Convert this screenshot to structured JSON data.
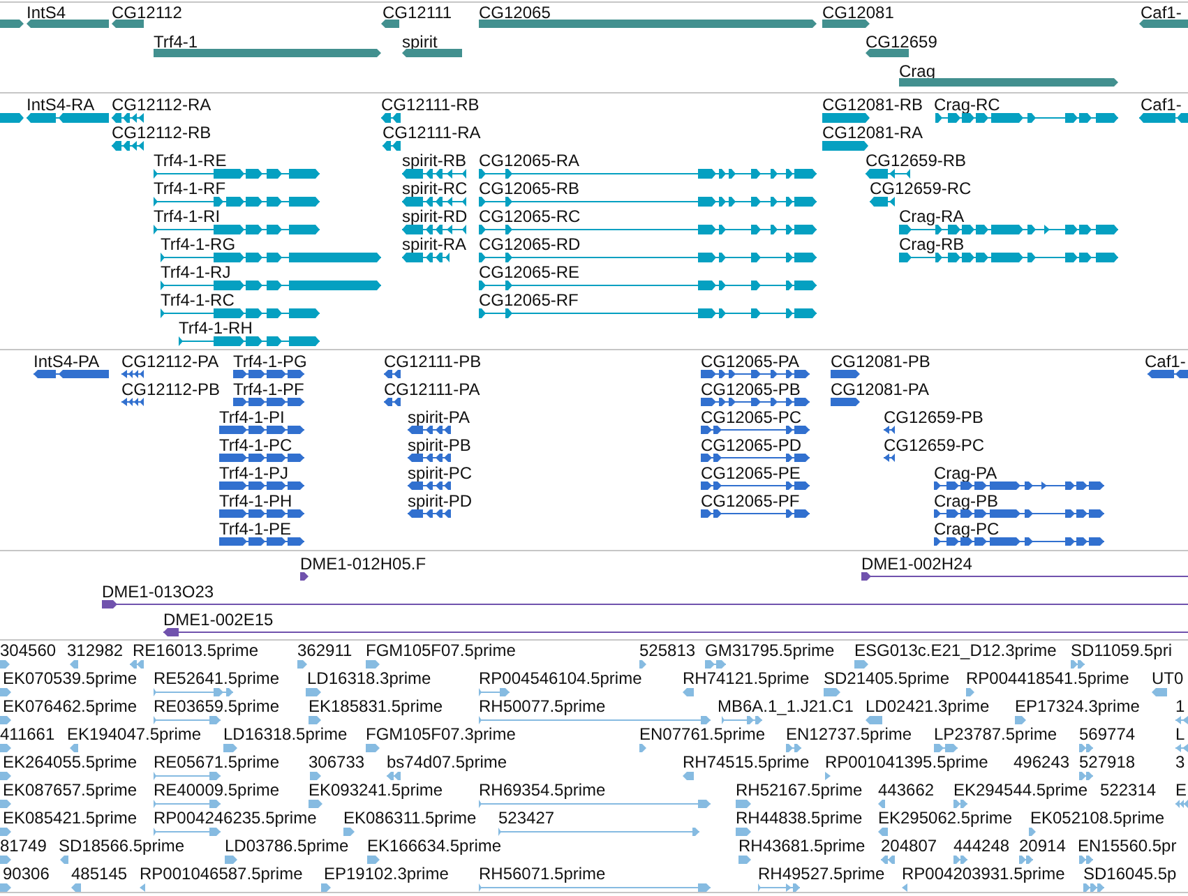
{
  "tracks": [
    {
      "kind": "gene",
      "lanes": [
        [
          {
            "reverse": false
          },
          {
            "label": "IntS4",
            "reverse": true
          },
          {
            "label": "CG12112",
            "reverse": true
          },
          {
            "label": "CG12111",
            "reverse": true
          },
          {
            "label": "CG12065",
            "reverse": false
          },
          {
            "label": "CG12081",
            "reverse": false
          },
          {
            "label": "Caf1-",
            "reverse": true
          }
        ],
        [
          {
            "label": "Trf4-1",
            "reverse": false
          },
          {
            "label": "spirit",
            "reverse": true
          },
          {
            "label": "CG12659",
            "reverse": true
          }
        ],
        [
          {
            "label": "Crag",
            "reverse": false
          }
        ]
      ]
    },
    {
      "kind": "transcript",
      "lanes": [
        [
          {
            "reverse": false
          },
          {
            "label": "IntS4-RA",
            "reverse": true
          },
          {
            "label": "CG12112-RA",
            "reverse": true
          },
          {
            "label": "CG12111-RB",
            "reverse": true
          },
          {
            "label": "CG12081-RB",
            "reverse": false
          },
          {
            "label": "Crag-RC",
            "reverse": false
          },
          {
            "label": "Caf1-",
            "reverse": true
          }
        ],
        [
          {
            "label": "CG12112-RB",
            "reverse": true
          },
          {
            "label": "CG12111-RA",
            "reverse": true
          },
          {
            "label": "CG12081-RA",
            "reverse": false
          }
        ],
        [
          {
            "label": "Trf4-1-RE",
            "reverse": false
          },
          {
            "label": "spirit-RB",
            "reverse": true
          },
          {
            "label": "CG12065-RA",
            "reverse": false
          },
          {
            "label": "CG12659-RB",
            "reverse": true
          }
        ],
        [
          {
            "label": "Trf4-1-RF",
            "reverse": false
          },
          {
            "label": "spirit-RC",
            "reverse": true
          },
          {
            "label": "CG12065-RB",
            "reverse": false
          },
          {
            "label": "CG12659-RC",
            "reverse": true
          }
        ],
        [
          {
            "label": "Trf4-1-RI",
            "reverse": false
          },
          {
            "label": "spirit-RD",
            "reverse": true
          },
          {
            "label": "CG12065-RC",
            "reverse": false
          },
          {
            "label": "Crag-RA",
            "reverse": false
          }
        ],
        [
          {
            "label": "Trf4-1-RG",
            "reverse": false
          },
          {
            "label": "spirit-RA",
            "reverse": true
          },
          {
            "label": "CG12065-RD",
            "reverse": false
          },
          {
            "label": "Crag-RB",
            "reverse": false
          }
        ],
        [
          {
            "label": "Trf4-1-RJ",
            "reverse": false
          },
          {
            "label": "CG12065-RE",
            "reverse": false
          }
        ],
        [
          {
            "label": "Trf4-1-RC",
            "reverse": false
          },
          {
            "label": "CG12065-RF",
            "reverse": false
          }
        ],
        [
          {
            "label": "Trf4-1-RH",
            "reverse": false
          }
        ]
      ]
    },
    {
      "kind": "protein",
      "lanes": [
        [
          {
            "label": "IntS4-PA",
            "reverse": true
          },
          {
            "label": "CG12112-PA",
            "reverse": true
          },
          {
            "label": "Trf4-1-PG",
            "reverse": false
          },
          {
            "label": "CG12111-PB",
            "reverse": true
          },
          {
            "label": "CG12065-PA",
            "reverse": false
          },
          {
            "label": "CG12081-PB",
            "reverse": false
          },
          {
            "label": "Caf1-",
            "reverse": true
          }
        ],
        [
          {
            "label": "CG12112-PB",
            "reverse": true
          },
          {
            "label": "Trf4-1-PF",
            "reverse": false
          },
          {
            "label": "CG12111-PA",
            "reverse": true
          },
          {
            "label": "CG12065-PB",
            "reverse": false
          },
          {
            "label": "CG12081-PA",
            "reverse": false
          }
        ],
        [
          {
            "label": "Trf4-1-PI",
            "reverse": false
          },
          {
            "label": "spirit-PA",
            "reverse": true
          },
          {
            "label": "CG12065-PC",
            "reverse": false
          },
          {
            "label": "CG12659-PB",
            "reverse": true
          }
        ],
        [
          {
            "label": "Trf4-1-PC",
            "reverse": false
          },
          {
            "label": "spirit-PB",
            "reverse": true
          },
          {
            "label": "CG12065-PD",
            "reverse": false
          },
          {
            "label": "CG12659-PC",
            "reverse": true
          }
        ],
        [
          {
            "label": "Trf4-1-PJ",
            "reverse": false
          },
          {
            "label": "spirit-PC",
            "reverse": true
          },
          {
            "label": "CG12065-PE",
            "reverse": false
          },
          {
            "label": "Crag-PA",
            "reverse": false
          }
        ],
        [
          {
            "label": "Trf4-1-PH",
            "reverse": false
          },
          {
            "label": "spirit-PD",
            "reverse": true
          },
          {
            "label": "CG12065-PF",
            "reverse": false
          },
          {
            "label": "Crag-PB",
            "reverse": false
          }
        ],
        [
          {
            "label": "Trf4-1-PE",
            "reverse": false
          },
          {
            "label": "Crag-PC",
            "reverse": false
          }
        ]
      ]
    },
    {
      "kind": "clone",
      "lanes": [
        [
          {
            "label": "DME1-012H05.F",
            "reverse": false
          },
          {
            "label": "DME1-002H24",
            "reverse": false
          }
        ],
        [
          {
            "label": "DME1-013O23",
            "reverse": false
          }
        ],
        [
          {
            "label": "DME1-002E15",
            "reverse": true
          }
        ]
      ]
    },
    {
      "kind": "est",
      "lanes": [
        [
          {
            "label": "304560",
            "reverse": false
          },
          {
            "label": "312982",
            "reverse": true
          },
          {
            "label": "RE16013.5prime",
            "reverse": true
          },
          {
            "label": "362911",
            "reverse": false
          },
          {
            "label": "FGM105F07.5prime",
            "reverse": false
          },
          {
            "label": "525813",
            "reverse": false
          },
          {
            "label": "GM31795.5prime",
            "reverse": false
          },
          {
            "label": "ESG013c.E21_D12.3prime",
            "reverse": false
          },
          {
            "label": "SD11059.5pri",
            "reverse": false
          }
        ],
        [
          {
            "label": "EK070539.5prime",
            "reverse": false
          },
          {
            "label": "RE52641.5prime",
            "reverse": false
          },
          {
            "label": "LD16318.3prime",
            "reverse": false
          },
          {
            "label": "RP004546104.5prime",
            "reverse": false
          },
          {
            "label": "RH74121.5prime",
            "reverse": true
          },
          {
            "label": "SD21405.5prime",
            "reverse": false
          },
          {
            "label": "RP004418541.5prime",
            "reverse": false
          },
          {
            "label": "UT0",
            "reverse": true
          }
        ],
        [
          {
            "label": "EK076462.5prime",
            "reverse": false
          },
          {
            "label": "RE03659.5prime",
            "reverse": false
          },
          {
            "label": "EK185831.5prime",
            "reverse": false
          },
          {
            "label": "RH50077.5prime",
            "reverse": false
          },
          {
            "label": "MB6A.1_1.J21.C1",
            "reverse": false
          },
          {
            "label": "LD02421.3prime",
            "reverse": true
          },
          {
            "label": "EP17324.3prime",
            "reverse": false
          },
          {
            "label": "1",
            "reverse": true
          }
        ],
        [
          {
            "label": "411661",
            "reverse": false
          },
          {
            "label": "EK194047.5prime",
            "reverse": true
          },
          {
            "label": "LD16318.5prime",
            "reverse": false
          },
          {
            "label": "FGM105F07.3prime",
            "reverse": false
          },
          {
            "label": "EN07761.5prime",
            "reverse": false
          },
          {
            "label": "EN12737.5prime",
            "reverse": false
          },
          {
            "label": "LP23787.5prime",
            "reverse": false
          },
          {
            "label": "569774",
            "reverse": false
          },
          {
            "label": "L",
            "reverse": true
          }
        ],
        [
          {
            "label": "EK264055.5prime",
            "reverse": false
          },
          {
            "label": "RE05671.5prime",
            "reverse": false
          },
          {
            "label": "306733",
            "reverse": false
          },
          {
            "label": "bs74d07.5prime",
            "reverse": true
          },
          {
            "label": "RH74515.5prime",
            "reverse": true
          },
          {
            "label": "RP001041395.5prime",
            "reverse": false
          },
          {
            "label": "496243"
          },
          {
            "label": "527918",
            "reverse": false
          },
          {
            "label": "3"
          }
        ],
        [
          {
            "label": "EK087657.5prime",
            "reverse": false
          },
          {
            "label": "RE40009.5prime",
            "reverse": false
          },
          {
            "label": "EK093241.5prime",
            "reverse": false
          },
          {
            "label": "RH69354.5prime",
            "reverse": false
          },
          {
            "label": "RH52167.5prime",
            "reverse": false
          },
          {
            "label": "443662",
            "reverse": true
          },
          {
            "label": "EK294544.5prime",
            "reverse": false
          },
          {
            "label": "522314"
          },
          {
            "label": "E",
            "reverse": true
          }
        ],
        [
          {
            "label": "EK085421.5prime",
            "reverse": false
          },
          {
            "label": "RP004246235.5prime",
            "reverse": false
          },
          {
            "label": "EK086311.5prime",
            "reverse": false
          },
          {
            "label": "523427",
            "reverse": false
          },
          {
            "label": "RH44838.5prime",
            "reverse": false
          },
          {
            "label": "EK295062.5prime",
            "reverse": true
          },
          {
            "label": "EK052108.5prime",
            "reverse": false
          }
        ],
        [
          {
            "label": "81749",
            "reverse": false
          },
          {
            "label": "SD18566.5prime",
            "reverse": true
          },
          {
            "label": "LD03786.5prime",
            "reverse": false
          },
          {
            "label": "EK166634.5prime",
            "reverse": false
          },
          {
            "label": "RH43681.5prime",
            "reverse": false
          },
          {
            "label": "204807",
            "reverse": true
          },
          {
            "label": "444248",
            "reverse": false
          },
          {
            "label": "20914",
            "reverse": false
          },
          {
            "label": "EN15560.5pr",
            "reverse": false
          }
        ],
        [
          {
            "label": "90306",
            "reverse": false
          },
          {
            "label": "485145",
            "reverse": true
          },
          {
            "label": "RP001046587.5prime",
            "reverse": true
          },
          {
            "label": "EP19102.3prime",
            "reverse": false
          },
          {
            "label": "RH56071.5prime",
            "reverse": false
          },
          {
            "label": "RH49527.5prime",
            "reverse": false
          },
          {
            "label": "RP004203931.5prime",
            "reverse": true
          },
          {
            "label": "SD16045.5p",
            "reverse": false
          }
        ]
      ]
    }
  ]
}
